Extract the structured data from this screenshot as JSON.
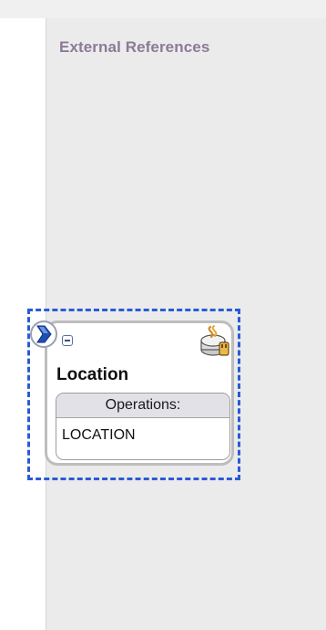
{
  "panel": {
    "title": "External References"
  },
  "component": {
    "name": "Location",
    "operations_header": "Operations:",
    "operations": [
      "LOCATION"
    ],
    "adapter_icon": "db-adapter-icon",
    "service_marker_icon": "service-arrow-icon",
    "collapse_icon": "collapse-minus-icon",
    "selection_color": "#2a5bd7"
  }
}
